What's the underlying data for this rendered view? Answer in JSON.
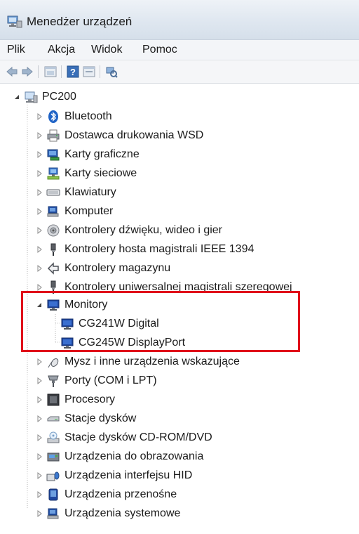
{
  "window": {
    "title": "Menedżer urządzeń"
  },
  "menu": [
    "Plik",
    "Akcja",
    "Widok",
    "Pomoc"
  ],
  "tree": {
    "root": "PC200",
    "categories": [
      {
        "label": "Bluetooth",
        "icon": "bluetooth-icon"
      },
      {
        "label": "Dostawca drukowania WSD",
        "icon": "printer-icon"
      },
      {
        "label": "Karty graficzne",
        "icon": "display-adapter-icon"
      },
      {
        "label": "Karty sieciowe",
        "icon": "network-adapter-icon"
      },
      {
        "label": "Klawiatury",
        "icon": "keyboard-icon"
      },
      {
        "label": "Komputer",
        "icon": "computer-icon"
      },
      {
        "label": "Kontrolery dźwięku, wideo i gier",
        "icon": "sound-icon"
      },
      {
        "label": "Kontrolery hosta magistrali IEEE 1394",
        "icon": "ieee1394-icon"
      },
      {
        "label": "Kontrolery magazynu",
        "icon": "storage-controller-icon"
      },
      {
        "label": "Kontrolery uniwersalnej magistrali szeregowej",
        "icon": "usb-icon"
      },
      {
        "label": "Monitory",
        "icon": "monitor-icon",
        "expanded": true,
        "children": [
          {
            "label": "CG241W Digital",
            "icon": "monitor-icon"
          },
          {
            "label": "CG245W DisplayPort",
            "icon": "monitor-icon"
          }
        ]
      },
      {
        "label": "Mysz i inne urządzenia wskazujące",
        "icon": "mouse-icon"
      },
      {
        "label": "Porty (COM i LPT)",
        "icon": "port-icon"
      },
      {
        "label": "Procesory",
        "icon": "processor-icon"
      },
      {
        "label": "Stacje dysków",
        "icon": "disk-drive-icon"
      },
      {
        "label": "Stacje dysków CD-ROM/DVD",
        "icon": "cdrom-icon"
      },
      {
        "label": "Urządzenia do obrazowania",
        "icon": "imaging-icon"
      },
      {
        "label": "Urządzenia interfejsu HID",
        "icon": "hid-icon"
      },
      {
        "label": "Urządzenia przenośne",
        "icon": "portable-device-icon"
      },
      {
        "label": "Urządzenia systemowe",
        "icon": "system-device-icon"
      }
    ]
  },
  "colors": {
    "highlight": "#e0101a",
    "titlebar": "#dfe7f0"
  }
}
